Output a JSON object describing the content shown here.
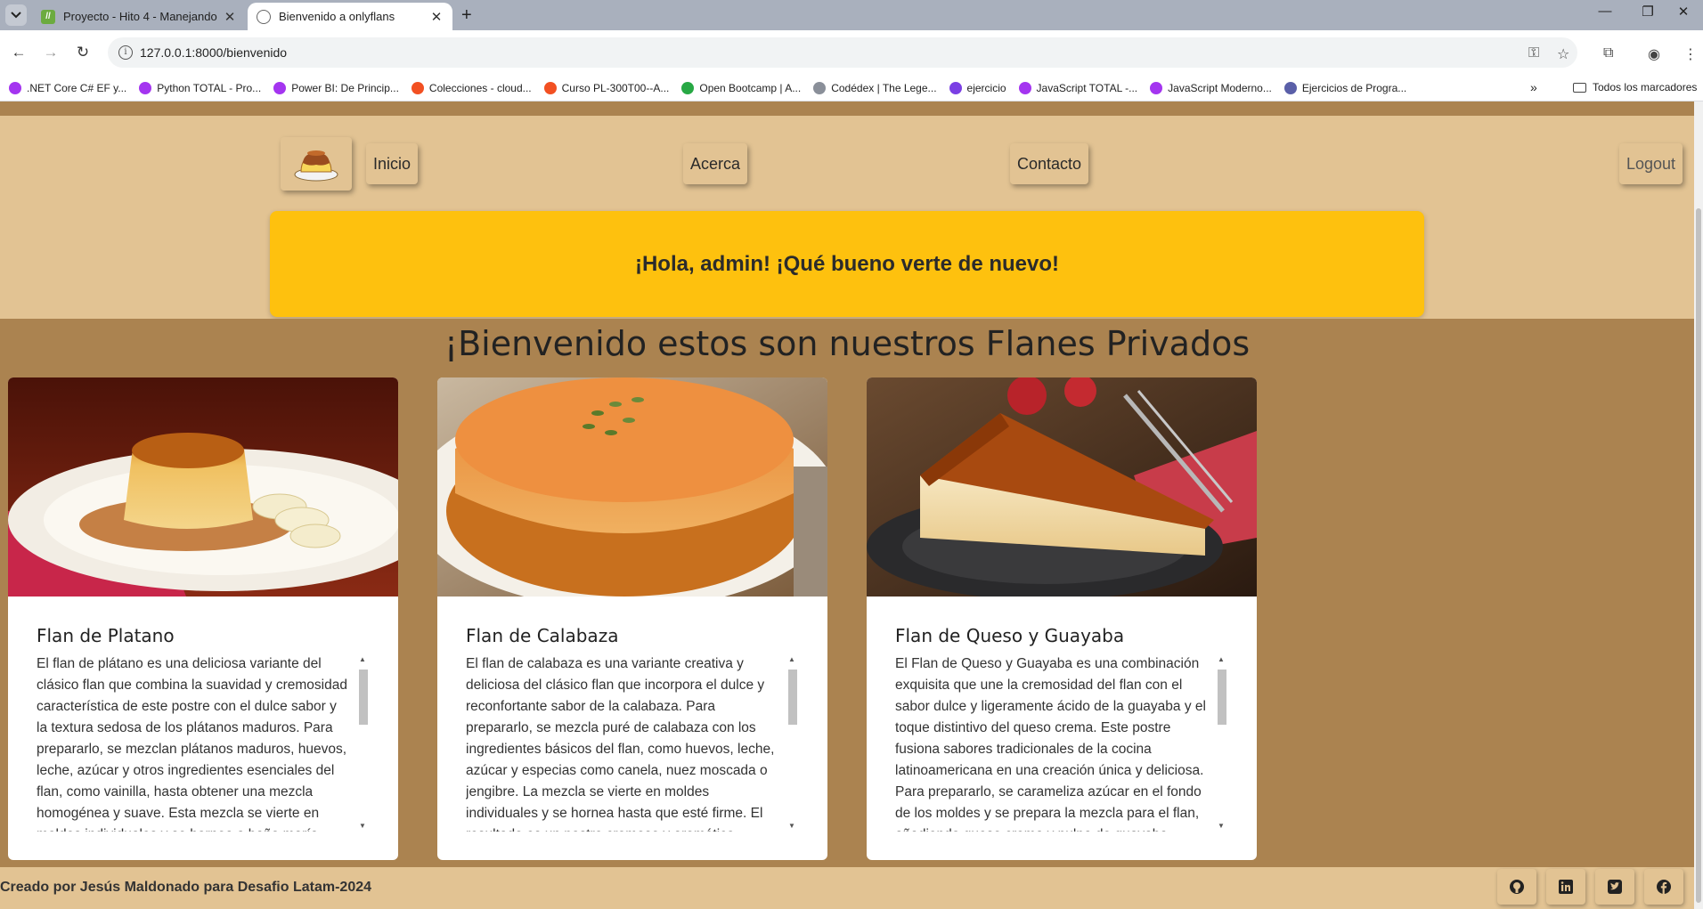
{
  "browser": {
    "tabs": [
      {
        "title": "Proyecto - Hito 4 - Manejando",
        "active": false
      },
      {
        "title": "Bienvenido a onlyflans",
        "active": true
      }
    ],
    "url": "127.0.0.1:8000/bienvenido",
    "bookmarks": [
      {
        "label": ".NET Core C# EF y...",
        "color": "#a435f0"
      },
      {
        "label": "Python TOTAL - Pro...",
        "color": "#a435f0"
      },
      {
        "label": "Power BI: De Princip...",
        "color": "#a435f0"
      },
      {
        "label": "Colecciones - cloud...",
        "color": "#f25022"
      },
      {
        "label": "Curso PL-300T00--A...",
        "color": "#f25022"
      },
      {
        "label": "Open Bootcamp | A...",
        "color": "#27a844"
      },
      {
        "label": "Codédex | The Lege...",
        "color": "#8a8f99"
      },
      {
        "label": "ejercicio",
        "color": "#7b3fe4"
      },
      {
        "label": "JavaScript TOTAL -...",
        "color": "#a435f0"
      },
      {
        "label": "JavaScript Moderno...",
        "color": "#a435f0"
      },
      {
        "label": "Ejercicios de Progra...",
        "color": "#5a5fa8"
      }
    ],
    "all_bookmarks_label": "Todos los marcadores"
  },
  "nav": {
    "logo_icon": "flan-logo-icon",
    "inicio": "Inicio",
    "acerca": "Acerca",
    "contacto": "Contacto",
    "logout": "Logout"
  },
  "welcome_message": "¡Hola, admin! ¡Qué bueno verte de nuevo!",
  "page_title": "¡Bienvenido estos son nuestros Flanes Privados",
  "cards": [
    {
      "title": "Flan de Platano",
      "text": "El flan de plátano es una deliciosa variante del clásico flan que combina la suavidad y cremosidad característica de este postre con el dulce sabor y la textura sedosa de los plátanos maduros. Para prepararlo, se mezclan plátanos maduros, huevos, leche, azúcar y otros ingredientes esenciales del flan, como vainilla, hasta obtener una mezcla homogénea y suave. Esta mezcla se vierte en moldes individuales y se hornea a baño maría."
    },
    {
      "title": "Flan de Calabaza",
      "text": "El flan de calabaza es una variante creativa y deliciosa del clásico flan que incorpora el dulce y reconfortante sabor de la calabaza. Para prepararlo, se mezcla puré de calabaza con los ingredientes básicos del flan, como huevos, leche, azúcar y especias como canela, nuez moscada o jengibre. La mezcla se vierte en moldes individuales y se hornea hasta que esté firme. El resultado es un postre cremoso y aromático."
    },
    {
      "title": "Flan de Queso y Guayaba",
      "text": "El Flan de Queso y Guayaba es una combinación exquisita que une la cremosidad del flan con el sabor dulce y ligeramente ácido de la guayaba y el toque distintivo del queso crema. Este postre fusiona sabores tradicionales de la cocina latinoamericana en una creación única y deliciosa. Para prepararlo, se carameliza azúcar en el fondo de los moldes y se prepara la mezcla para el flan, añadiendo queso crema y pulpa de guayaba."
    }
  ],
  "footer": {
    "text": "Creado por Jesús Maldonado para Desafio Latam-2024",
    "social": [
      "github-icon",
      "linkedin-icon",
      "twitter-icon",
      "facebook-icon"
    ]
  },
  "colors": {
    "header_bg": "#e2c393",
    "main_bg": "#ab8350",
    "welcome_bg": "#fec10e"
  }
}
